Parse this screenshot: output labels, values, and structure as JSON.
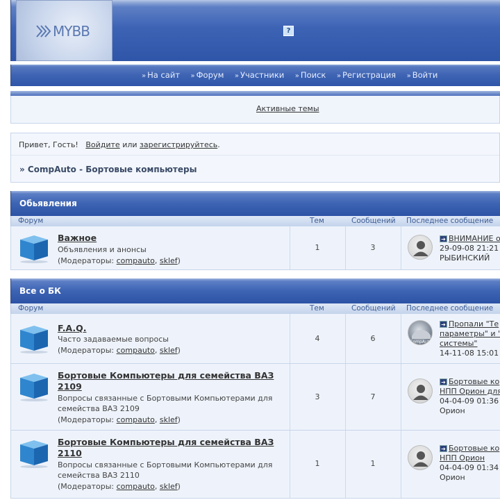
{
  "header": {
    "logo_text": "MYBB",
    "help_icon": "question-icon",
    "help_label": "?"
  },
  "nav": {
    "items": [
      {
        "label": "На сайт"
      },
      {
        "label": "Форум"
      },
      {
        "label": "Участники"
      },
      {
        "label": "Поиск"
      },
      {
        "label": "Регистрация"
      },
      {
        "label": "Войти"
      }
    ]
  },
  "active_topics": {
    "label": "Активные темы"
  },
  "welcome": {
    "greeting": "Привет, Гость!",
    "login_label": "Войдите",
    "or": "или",
    "register_label": "зарегистрируйтесь",
    "period": "."
  },
  "breadcrumb": {
    "label": "» CompAuto - Бортовые компьютеры"
  },
  "columns": {
    "forum": "Форум",
    "topics": "Тем",
    "posts": "Сообщений",
    "last": "Последнее сообщение"
  },
  "mods_prefix": "(Модераторы:",
  "mods_comma": ",",
  "mods_suffix": ")",
  "categories": [
    {
      "title": "Обьявления",
      "forums": [
        {
          "title": "Важное",
          "desc": "Объявления и анонсы",
          "mods": [
            "compauto",
            "sklef"
          ],
          "topics": "1",
          "posts": "3",
          "last_title": "ВНИМАНИЕ о",
          "last_date": "29-09-08 21:21",
          "last_user": "РЫБИНСКИЙ"
        }
      ]
    },
    {
      "title": "Все о БК",
      "forums": [
        {
          "title": "F.A.Q.",
          "desc": "Часто задаваемые вопросы",
          "mods": [
            "compauto",
            "sklef"
          ],
          "topics": "4",
          "posts": "6",
          "last_title_1": "Пропали \"Те",
          "last_title_2": "параметры\" и \"",
          "last_title_3": "системы\"",
          "last_date": "14-11-08 15:01"
        },
        {
          "title": "Бортовые Компьютеры для семейства ВАЗ 2109",
          "desc": "Вопросы связанные с Бортовыми Компьютерами для семейства ВАЗ 2109",
          "mods": [
            "compauto",
            "sklef"
          ],
          "topics": "3",
          "posts": "7",
          "last_title_1": "Бортовые ко",
          "last_title_2": "НПП Орион для",
          "last_date": "04-04-09 01:36",
          "last_user": "Орион"
        },
        {
          "title": "Бортовые Компьютеры для семейства ВАЗ 2110",
          "desc": "Вопросы связанные с Бортовыми Компьютерами для семейства ВАЗ 2110",
          "mods": [
            "compauto",
            "sklef"
          ],
          "topics": "1",
          "posts": "1",
          "last_title_1": "Бортовые ко",
          "last_title_2": "НПП Орион",
          "last_date": "04-04-09 01:34",
          "last_user": "Орион"
        }
      ]
    }
  ]
}
